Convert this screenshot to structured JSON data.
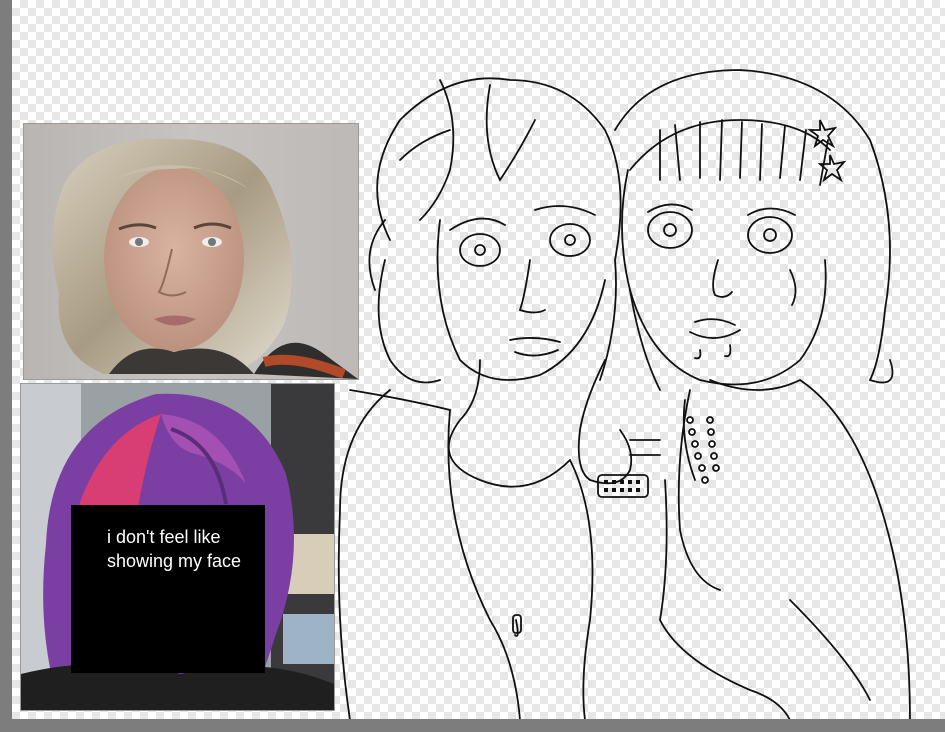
{
  "reference_photos": [
    {
      "name": "blonde-hair-reference"
    },
    {
      "name": "purple-hair-reference"
    }
  ],
  "overlay": {
    "text": "i don't feel like showing my face"
  },
  "colors": {
    "workspace_gray": "#8c8c8c",
    "checker_light": "#ffffff",
    "checker_dark": "#e6e6e6",
    "overlay_black": "#000000",
    "hair_purple": "#7b3fa3",
    "hair_pink": "#d83d74",
    "sketch_line": "#111111"
  }
}
